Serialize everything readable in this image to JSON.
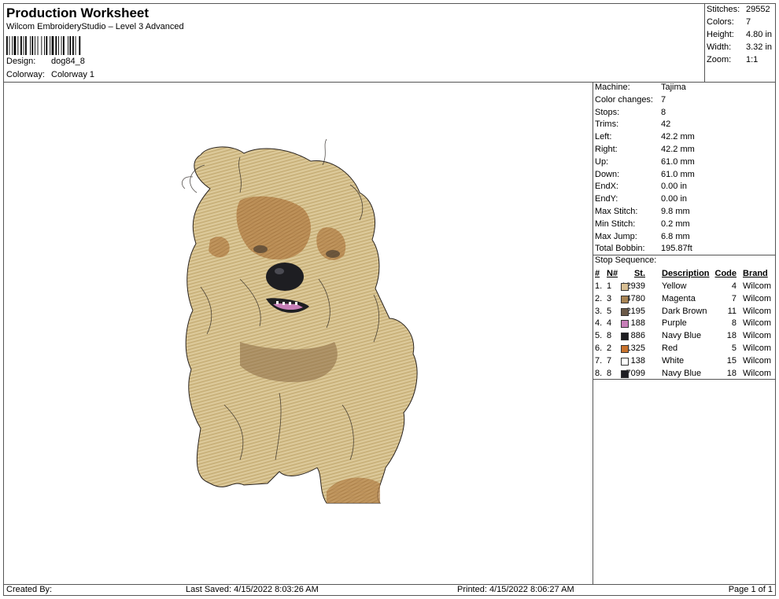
{
  "header": {
    "title": "Production Worksheet",
    "software": "Wilcom EmbroideryStudio – Level 3 Advanced",
    "design_label": "Design:",
    "design_value": "dog84_8",
    "colorway_label": "Colorway:",
    "colorway_value": "Colorway 1"
  },
  "summary": {
    "stitches_label": "Stitches:",
    "stitches_value": "29552",
    "colors_label": "Colors:",
    "colors_value": "7",
    "height_label": "Height:",
    "height_value": "4.80 in",
    "width_label": "Width:",
    "width_value": "3.32 in",
    "zoom_label": "Zoom:",
    "zoom_value": "1:1"
  },
  "machine_info": [
    {
      "label": "Machine:",
      "value": "Tajima"
    },
    {
      "label": "Color changes:",
      "value": "7"
    },
    {
      "label": "Stops:",
      "value": "8"
    },
    {
      "label": "Trims:",
      "value": "42"
    },
    {
      "label": "Left:",
      "value": "42.2 mm"
    },
    {
      "label": "Right:",
      "value": "42.2 mm"
    },
    {
      "label": "Up:",
      "value": "61.0 mm"
    },
    {
      "label": "Down:",
      "value": "61.0 mm"
    },
    {
      "label": "EndX:",
      "value": "0.00 in"
    },
    {
      "label": "EndY:",
      "value": "0.00 in"
    },
    {
      "label": "Max Stitch:",
      "value": "9.8 mm"
    },
    {
      "label": "Min Stitch:",
      "value": "0.2 mm"
    },
    {
      "label": "Max Jump:",
      "value": "6.8 mm"
    },
    {
      "label": "Total Bobbin:",
      "value": "195.87ft"
    }
  ],
  "stop_sequence": {
    "title": "Stop Sequence:",
    "headers": {
      "idx": "#",
      "n": "N#",
      "st": "St.",
      "desc": "Description",
      "code": "Code",
      "brand": "Brand"
    },
    "rows": [
      {
        "idx": "1.",
        "n": "1",
        "color": "#d8bf94",
        "st": "12939",
        "desc": "Yellow",
        "code": "4",
        "brand": "Wilcom"
      },
      {
        "idx": "2.",
        "n": "3",
        "color": "#a88454",
        "st": "4780",
        "desc": "Magenta",
        "code": "7",
        "brand": "Wilcom"
      },
      {
        "idx": "3.",
        "n": "5",
        "color": "#6b5a48",
        "st": "2195",
        "desc": "Dark Brown",
        "code": "11",
        "brand": "Wilcom"
      },
      {
        "idx": "4.",
        "n": "4",
        "color": "#c77fb8",
        "st": "188",
        "desc": "Purple",
        "code": "8",
        "brand": "Wilcom"
      },
      {
        "idx": "5.",
        "n": "8",
        "color": "#1e1e22",
        "st": "886",
        "desc": "Navy Blue",
        "code": "18",
        "brand": "Wilcom"
      },
      {
        "idx": "6.",
        "n": "2",
        "color": "#c8722c",
        "st": "1325",
        "desc": "Red",
        "code": "5",
        "brand": "Wilcom"
      },
      {
        "idx": "7.",
        "n": "7",
        "color": "#ffffff",
        "st": "138",
        "desc": "White",
        "code": "15",
        "brand": "Wilcom"
      },
      {
        "idx": "8.",
        "n": "8",
        "color": "#1e1e22",
        "st": "7099",
        "desc": "Navy Blue",
        "code": "18",
        "brand": "Wilcom"
      }
    ]
  },
  "footer": {
    "created_by": "Created By:",
    "last_saved": "Last Saved: 4/15/2022 8:03:26 AM",
    "printed": "Printed: 4/15/2022 8:06:27 AM",
    "page": "Page 1 of 1"
  }
}
